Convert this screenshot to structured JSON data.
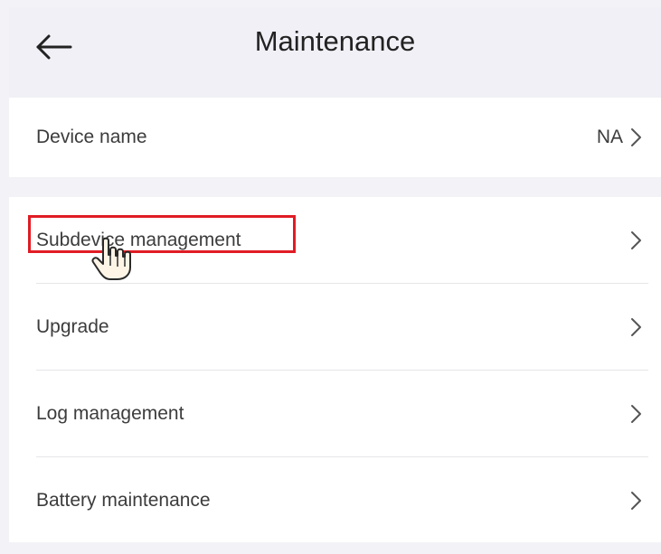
{
  "header": {
    "title": "Maintenance",
    "back_icon": "arrow-left-icon"
  },
  "device_section": {
    "device_name_label": "Device name",
    "device_name_value": "NA"
  },
  "menu": {
    "items": [
      {
        "label": "Subdevice management",
        "icon": "chevron-right-icon"
      },
      {
        "label": "Upgrade",
        "icon": "chevron-right-icon"
      },
      {
        "label": "Log management",
        "icon": "chevron-right-icon"
      },
      {
        "label": "Battery maintenance",
        "icon": "chevron-right-icon"
      }
    ]
  },
  "annotation": {
    "highlight_color": "#e01c24",
    "cursor_icon": "hand-pointer-icon"
  }
}
